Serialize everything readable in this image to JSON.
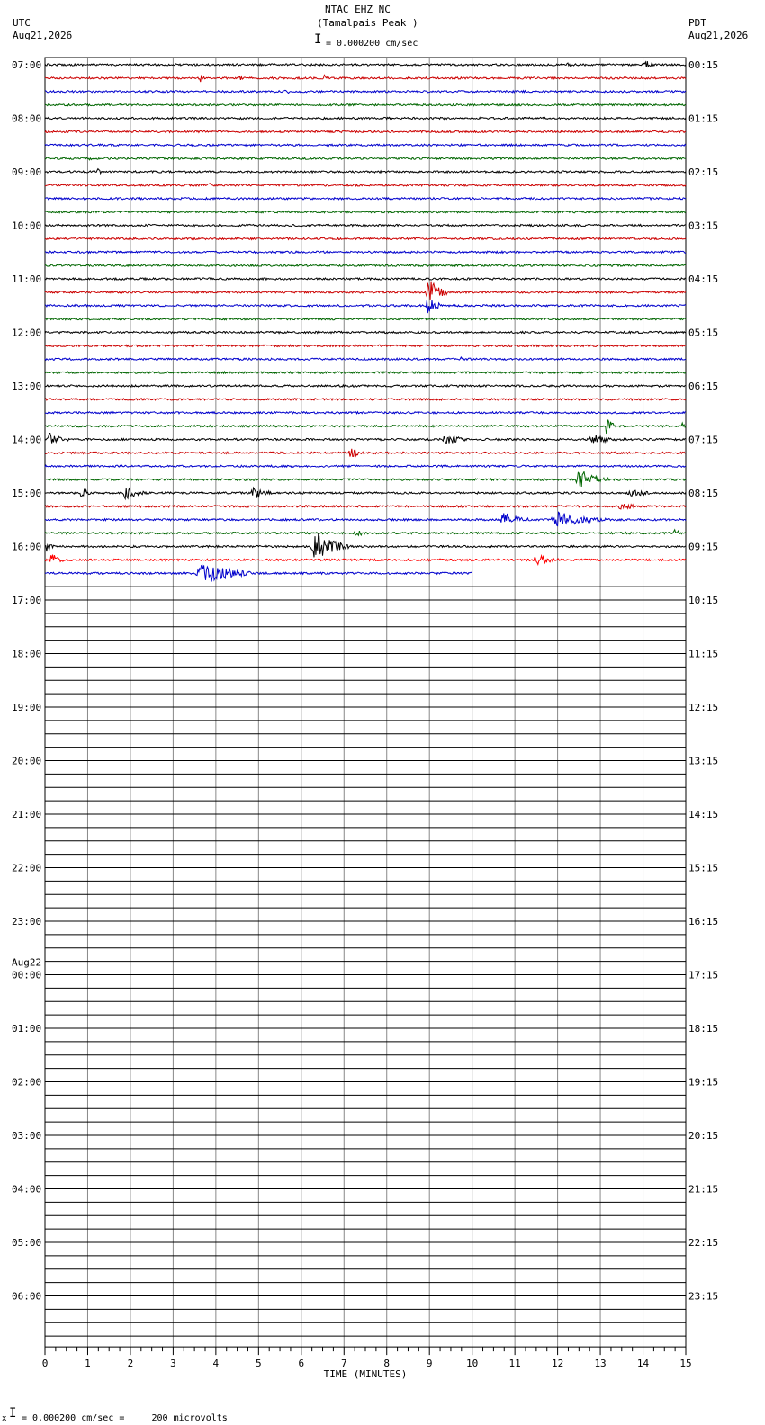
{
  "header": {
    "station": "NTAC EHZ NC",
    "site": "(Tamalpais Peak )",
    "scale_label": "= 0.000200 cm/sec",
    "left_tz": "UTC",
    "left_date": "Aug21,2026",
    "right_tz": "PDT",
    "right_date": "Aug21,2026"
  },
  "footer": {
    "scale_text": "= 0.000200 cm/sec =     200 microvolts"
  },
  "chart_data": {
    "type": "line",
    "title": "NTAC EHZ NC (Tamalpais Peak )",
    "xlabel": "TIME (MINUTES)",
    "xlim": [
      0,
      15
    ],
    "x_ticks": [
      "0",
      "1",
      "2",
      "3",
      "4",
      "5",
      "6",
      "7",
      "8",
      "9",
      "10",
      "11",
      "12",
      "13",
      "14",
      "15"
    ],
    "rows_per_hour": 4,
    "hour_labels_utc": [
      "07:00",
      "08:00",
      "09:00",
      "10:00",
      "11:00",
      "12:00",
      "13:00",
      "14:00",
      "15:00",
      "16:00",
      "17:00",
      "18:00",
      "19:00",
      "20:00",
      "21:00",
      "22:00",
      "23:00",
      "00:00",
      "01:00",
      "02:00",
      "03:00",
      "04:00",
      "05:00",
      "06:00"
    ],
    "date_change_label": "Aug22",
    "date_change_hour_index": 17,
    "hour_labels_pdt": [
      "00:15",
      "01:15",
      "02:15",
      "03:15",
      "04:15",
      "05:15",
      "06:15",
      "07:15",
      "08:15",
      "09:15",
      "10:15",
      "11:15",
      "12:15",
      "13:15",
      "14:15",
      "15:15",
      "16:15",
      "17:15",
      "18:15",
      "19:15",
      "20:15",
      "21:15",
      "22:15",
      "23:15"
    ],
    "trace_colors": [
      "#000000",
      "#cc0000",
      "#0000cc",
      "#006600"
    ],
    "last_row_color": "#ff0000",
    "recorded_rows": 39,
    "last_row_end_minute": 10,
    "events": [
      {
        "row": 0,
        "start": 14.0,
        "end": 14.4,
        "amp": 5
      },
      {
        "row": 0,
        "start": 12.2,
        "end": 12.4,
        "amp": 4
      },
      {
        "row": 1,
        "start": 3.6,
        "end": 3.8,
        "amp": 5
      },
      {
        "row": 1,
        "start": 4.5,
        "end": 4.7,
        "amp": 4
      },
      {
        "row": 1,
        "start": 6.5,
        "end": 6.7,
        "amp": 4
      },
      {
        "row": 2,
        "start": 5.6,
        "end": 5.8,
        "amp": 4
      },
      {
        "row": 2,
        "start": 13.5,
        "end": 13.7,
        "amp": 4
      },
      {
        "row": 7,
        "start": 1.0,
        "end": 1.3,
        "amp": 4
      },
      {
        "row": 8,
        "start": 1.2,
        "end": 1.4,
        "amp": 4
      },
      {
        "row": 9,
        "start": 3.8,
        "end": 4.0,
        "amp": 4
      },
      {
        "row": 17,
        "start": 8.9,
        "end": 9.4,
        "amp": 18
      },
      {
        "row": 18,
        "start": 8.9,
        "end": 9.3,
        "amp": 12
      },
      {
        "row": 22,
        "start": 9.7,
        "end": 9.9,
        "amp": 3
      },
      {
        "row": 27,
        "start": 13.1,
        "end": 13.4,
        "amp": 10
      },
      {
        "row": 27,
        "start": 14.9,
        "end": 15.0,
        "amp": 6
      },
      {
        "row": 28,
        "start": 0.0,
        "end": 0.6,
        "amp": 8
      },
      {
        "row": 28,
        "start": 9.3,
        "end": 9.9,
        "amp": 8
      },
      {
        "row": 28,
        "start": 12.7,
        "end": 13.6,
        "amp": 6
      },
      {
        "row": 29,
        "start": 7.1,
        "end": 7.5,
        "amp": 7
      },
      {
        "row": 31,
        "start": 12.4,
        "end": 13.2,
        "amp": 12
      },
      {
        "row": 32,
        "start": 0.8,
        "end": 1.1,
        "amp": 8
      },
      {
        "row": 32,
        "start": 1.8,
        "end": 2.4,
        "amp": 9
      },
      {
        "row": 32,
        "start": 4.8,
        "end": 5.4,
        "amp": 8
      },
      {
        "row": 32,
        "start": 13.6,
        "end": 14.2,
        "amp": 8
      },
      {
        "row": 33,
        "start": 13.4,
        "end": 14.0,
        "amp": 5
      },
      {
        "row": 34,
        "start": 10.6,
        "end": 11.4,
        "amp": 9
      },
      {
        "row": 34,
        "start": 11.8,
        "end": 13.2,
        "amp": 9
      },
      {
        "row": 35,
        "start": 7.2,
        "end": 7.6,
        "amp": 6
      },
      {
        "row": 35,
        "start": 14.7,
        "end": 15.0,
        "amp": 5
      },
      {
        "row": 36,
        "start": 0.0,
        "end": 0.3,
        "amp": 7
      },
      {
        "row": 36,
        "start": 6.2,
        "end": 7.1,
        "amp": 18
      },
      {
        "row": 37,
        "start": 0.1,
        "end": 0.5,
        "amp": 9
      },
      {
        "row": 37,
        "start": 11.4,
        "end": 12.2,
        "amp": 6
      },
      {
        "row": 38,
        "start": 3.5,
        "end": 4.8,
        "amp": 14
      }
    ]
  }
}
